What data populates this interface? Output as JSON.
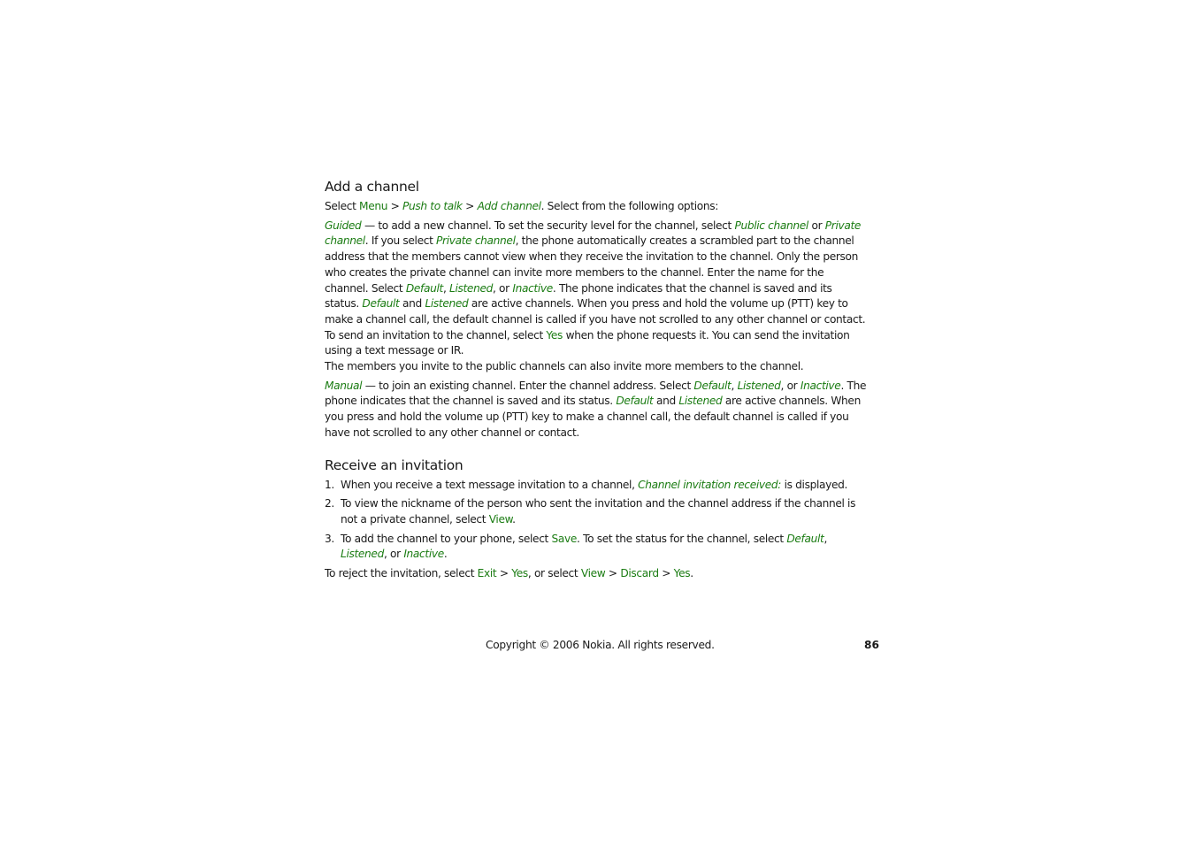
{
  "section1": {
    "title": "Add a channel",
    "intro": {
      "pre": "Select ",
      "menu": "Menu",
      "sep1": " > ",
      "ptt": "Push to talk",
      "sep2": " > ",
      "add": "Add channel",
      "post": ". Select from the following options:"
    },
    "guided": {
      "t0": "Guided",
      "t1": " — to add a new channel. To set the security level for the channel, select ",
      "t2": "Public channel",
      "t3": " or ",
      "t4": "Private channel",
      "t5": ". If you select ",
      "t6": "Private channel",
      "t7": ", the phone automatically creates a scrambled part to the channel address that the members cannot view when they receive the invitation to the channel. Only the person who creates the private channel can invite more members to the channel. Enter the name for the channel. Select ",
      "t8": "Default",
      "t9": ", ",
      "t10": "Listened",
      "t11": ", or ",
      "t12": "Inactive",
      "t13": ". The phone indicates that the channel is saved and its status. ",
      "t14": "Default",
      "t15": " and ",
      "t16": "Listened",
      "t17": " are active channels. When you press and hold the volume up (PTT) key to make a channel call, the default channel is called if you have not scrolled to any other channel or contact. To send an invitation to the channel, select ",
      "t18": "Yes",
      "t19": " when the phone requests it. You can send the invitation using a text message or IR."
    },
    "public_note": "The members you invite to the public channels can also invite more members to the channel.",
    "manual": {
      "t0": "Manual",
      "t1": " — to join an existing channel. Enter the channel address. Select ",
      "t2": "Default",
      "t3": ", ",
      "t4": "Listened",
      "t5": ", or ",
      "t6": "Inactive",
      "t7": ". The phone indicates that the channel is saved and its status. ",
      "t8": "Default",
      "t9": " and ",
      "t10": "Listened",
      "t11": " are active channels. When you press and hold the volume up (PTT) key to make a channel call, the default channel is called if you have not scrolled to any other channel or contact."
    }
  },
  "section2": {
    "title": "Receive an invitation",
    "steps": [
      {
        "num": "1.",
        "t0": "When you receive a text message invitation to a channel, ",
        "t1": "Channel invitation received:",
        "t2": " is displayed."
      },
      {
        "num": "2.",
        "t0": "To view the nickname of the person who sent the invitation and the channel address if the channel is not a private channel, select ",
        "t1": "View",
        "t2": "."
      },
      {
        "num": "3.",
        "t0": "To add the channel to your phone, select ",
        "t1": "Save",
        "t2": ". To set the status for the channel, select ",
        "t3": "Default",
        "t4": ", ",
        "t5": "Listened",
        "t6": ", or ",
        "t7": "Inactive",
        "t8": "."
      }
    ],
    "reject": {
      "t0": "To reject the invitation, select ",
      "t1": "Exit",
      "t2": " > ",
      "t3": "Yes",
      "t4": ", or select ",
      "t5": "View",
      "t6": " > ",
      "t7": "Discard",
      "t8": " > ",
      "t9": "Yes",
      "t10": "."
    }
  },
  "footer": {
    "copyright": "Copyright © 2006 Nokia. All rights reserved.",
    "page_number": "86"
  },
  "colors": {
    "accent_green": "#1b7c13",
    "text": "#1a1a1a"
  }
}
